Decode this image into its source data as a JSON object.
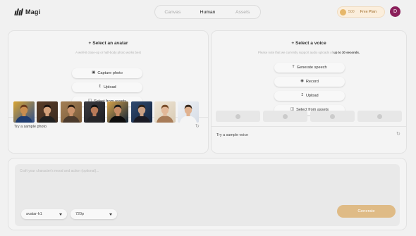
{
  "header": {
    "brand": "Magi",
    "tabs": [
      {
        "label": "Canvas",
        "active": false
      },
      {
        "label": "Human",
        "active": true
      },
      {
        "label": "Assets",
        "active": false
      }
    ],
    "credits": "500",
    "plan_label": "Free Plan",
    "user_initial": "D"
  },
  "avatar_panel": {
    "title": "+ Select an avatar",
    "subtitle": "A well-lit close-up or half-body photo works best",
    "buttons": [
      {
        "label": "Capture photo",
        "icon": "camera-icon"
      },
      {
        "label": "Upload",
        "icon": "upload-icon"
      },
      {
        "label": "Select from assets",
        "icon": "folder-icon"
      }
    ],
    "samples_label": "Try a sample photo",
    "sample_count": 8
  },
  "voice_panel": {
    "title": "+ Select a voice",
    "subtitle": "Please note that we currently support audio uploads of",
    "subtitle_strong": "up to 30 seconds.",
    "buttons": [
      {
        "label": "Generate speech",
        "icon": "text-icon"
      },
      {
        "label": "Record",
        "icon": "record-icon"
      },
      {
        "label": "Upload",
        "icon": "upload-icon"
      },
      {
        "label": "Select from assets",
        "icon": "folder-icon"
      }
    ],
    "samples_label": "Try a sample voice",
    "sample_count": 4
  },
  "prompt": {
    "placeholder": "Craft your character's mood and action (optional)...",
    "model_select": "avatar-h1",
    "resolution_select": "720p",
    "generate_label": "Generate"
  },
  "colors": {
    "accent": "#dfbb86",
    "avatar_bg": "#8a1f5a",
    "plan_bg": "#fbeedc"
  }
}
